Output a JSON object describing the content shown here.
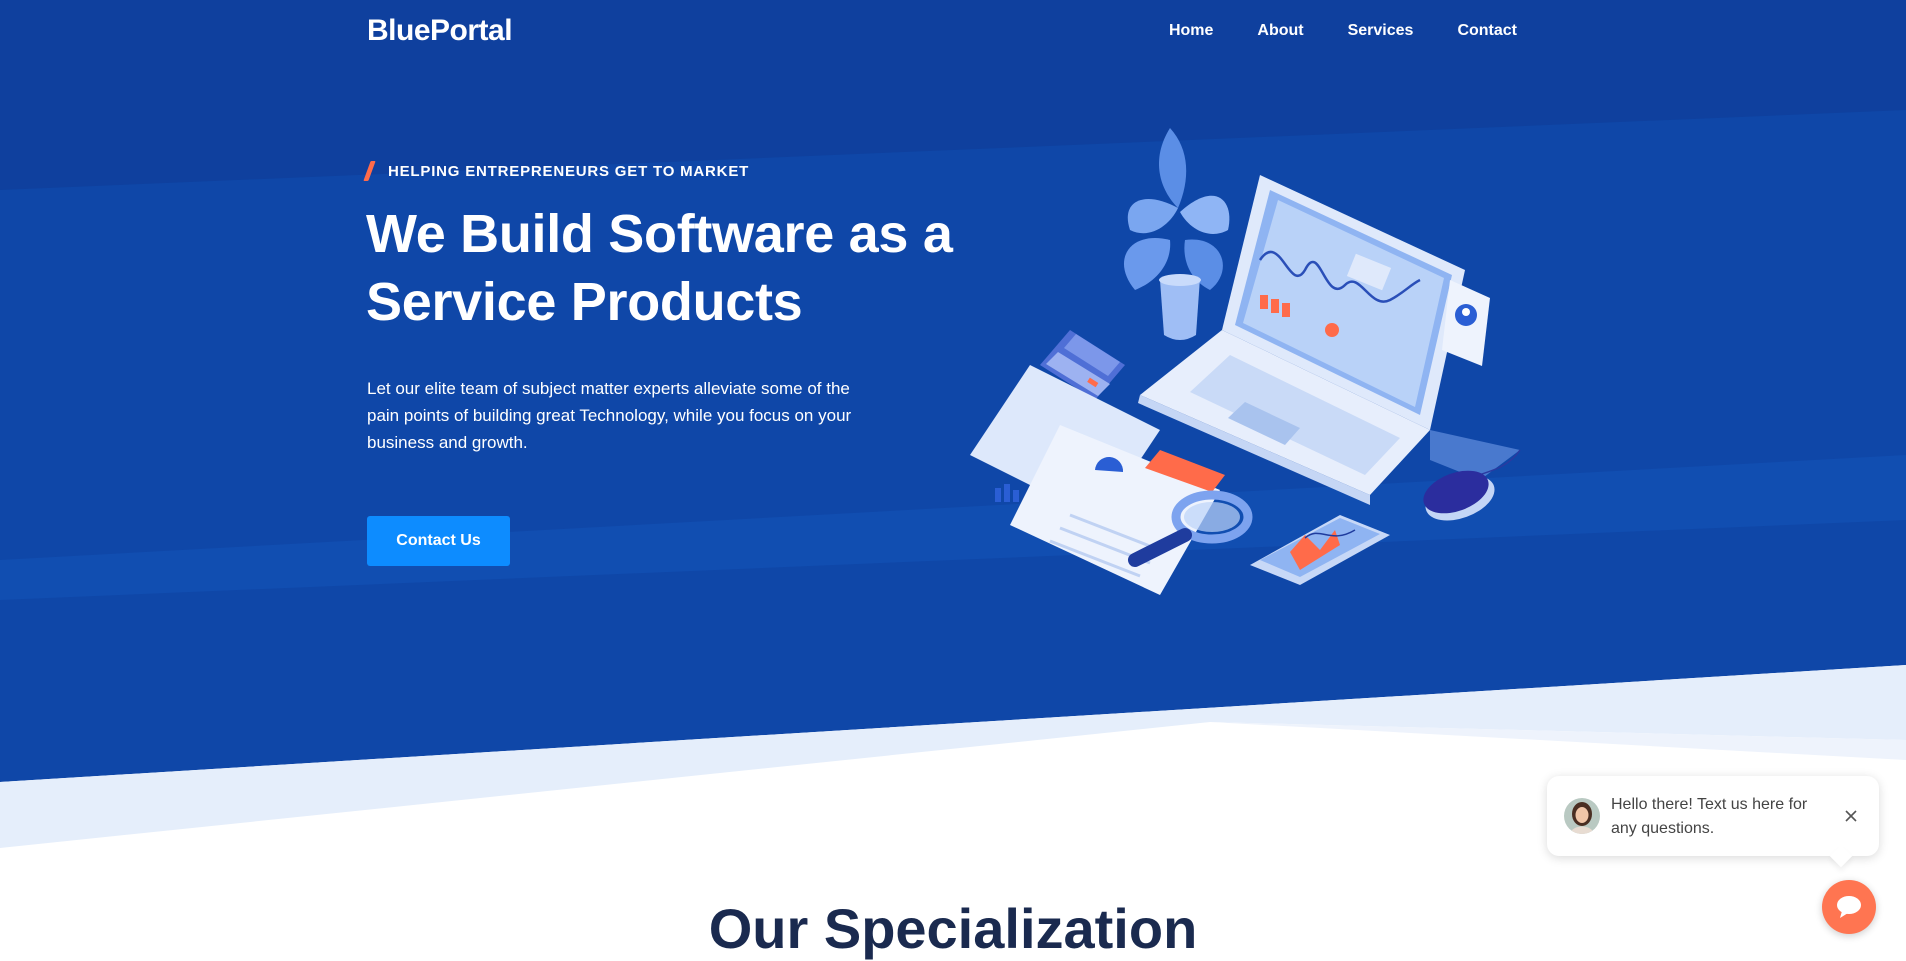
{
  "brand": {
    "name": "BluePortal"
  },
  "nav": {
    "items": [
      "Home",
      "About",
      "Services",
      "Contact"
    ]
  },
  "hero": {
    "eyebrow": "HELPING ENTREPRENEURS GET TO MARKET",
    "title": "We Build Software as a Service Products",
    "description": "Let our elite team of subject matter experts alleviate some of the pain points of building great Technology, while you focus on your business and growth.",
    "cta_label": "Contact Us"
  },
  "sections": {
    "specialization_title": "Our Specialization"
  },
  "chat": {
    "message": "Hello there! Text us here for any questions.",
    "close_icon": "close-icon",
    "launcher_icon": "chat-bubble-icon"
  },
  "colors": {
    "hero_bg": "#0f47a8",
    "accent_orange": "#ff6b4a",
    "cta_blue": "#0d8cff",
    "heading_dark": "#1a2a4f"
  }
}
